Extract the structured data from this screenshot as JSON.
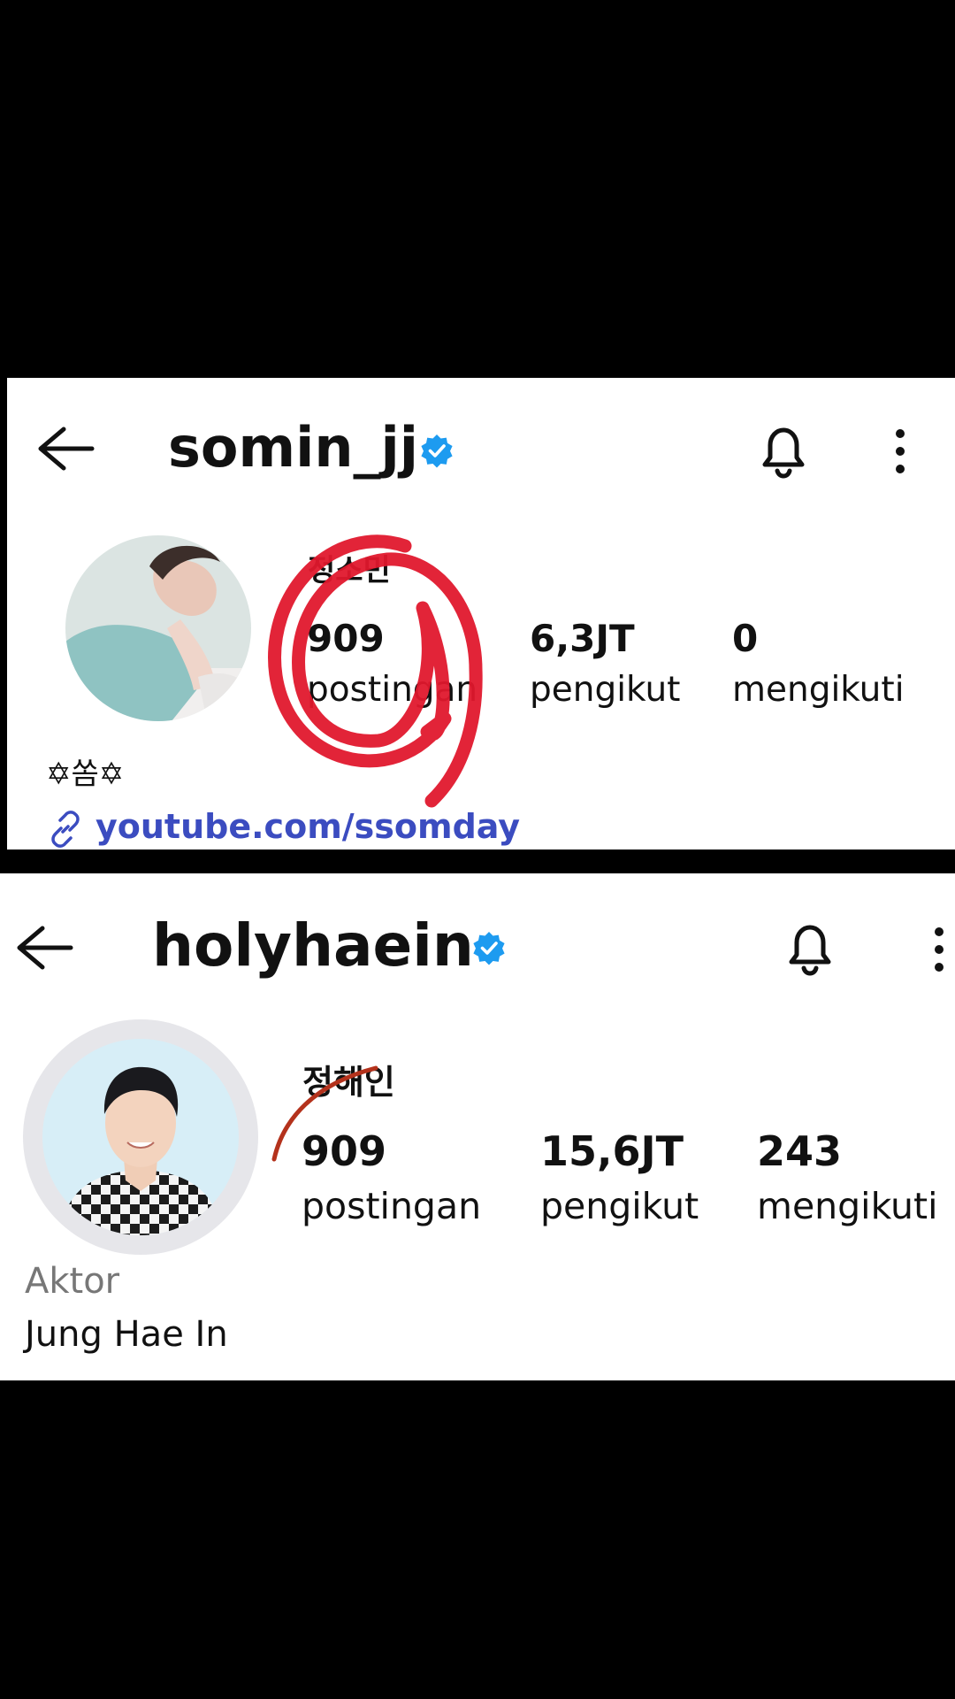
{
  "profiles": [
    {
      "username": "somin_jj",
      "name": "정소민",
      "stats": [
        {
          "value": "909",
          "label": "postingan"
        },
        {
          "value": "6,3JT",
          "label": "pengikut"
        },
        {
          "value": "0",
          "label": "mengikuti"
        }
      ],
      "bio": "✡쏨✡",
      "link": "youtube.com/ssomday"
    },
    {
      "username": "holyhaein",
      "name": "정해인",
      "stats": [
        {
          "value": "909",
          "label": "postingan"
        },
        {
          "value": "15,6JT",
          "label": "pengikut"
        },
        {
          "value": "243",
          "label": "mengikuti"
        }
      ],
      "category": "Aktor",
      "bio": "Jung Hae In"
    }
  ],
  "icons": {
    "back": "arrow-left-icon",
    "verified": "verified-badge-icon",
    "bell": "bell-icon",
    "more": "more-vertical-icon",
    "link": "link-icon"
  },
  "colors": {
    "verified": "#1d9bf0",
    "link": "#3b4cc0",
    "annotation_red": "#e0182d",
    "annotation_brown": "#b4321c"
  }
}
